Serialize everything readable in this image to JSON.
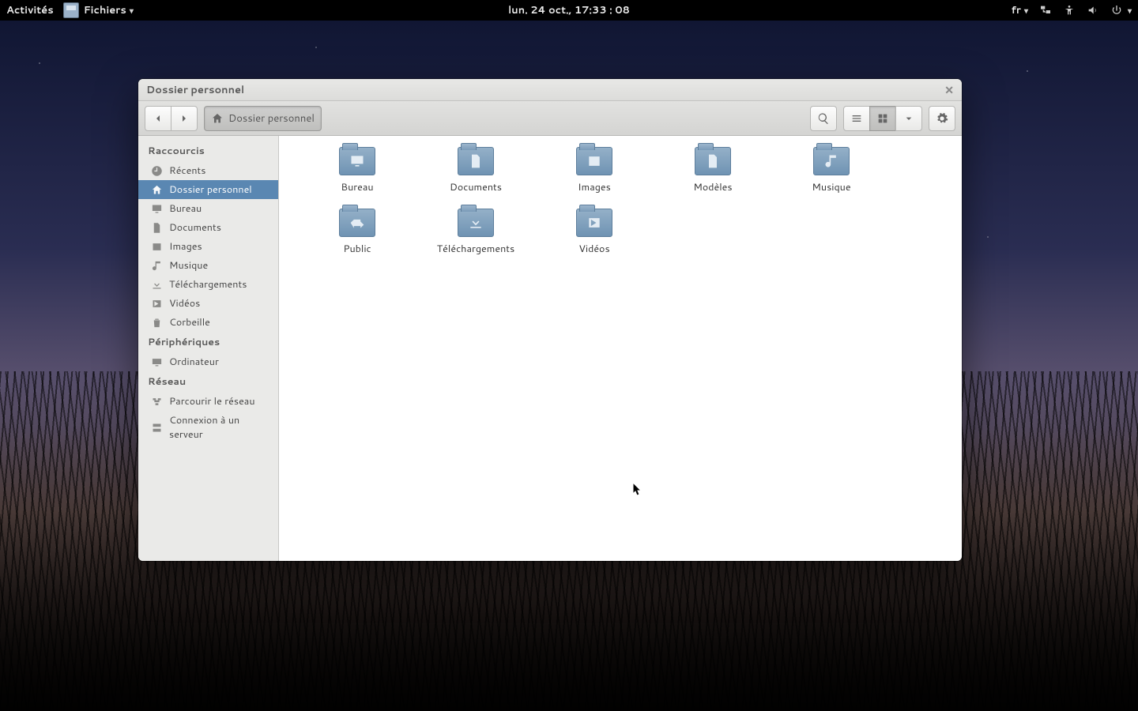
{
  "topbar": {
    "activities": "Activités",
    "app_menu": "Fichiers",
    "clock": "lun. 24 oct., 17:33 : 08",
    "keyboard_layout": "fr"
  },
  "window": {
    "title": "Dossier personnel",
    "breadcrumb": {
      "home_label": "Dossier personnel"
    }
  },
  "sidebar": {
    "headers": {
      "0": "Raccourcis",
      "1": "Périphériques",
      "2": "Réseau"
    },
    "shortcuts": [
      {
        "label": "Récents",
        "icon": "clock"
      },
      {
        "label": "Dossier personnel",
        "icon": "home",
        "selected": true
      },
      {
        "label": "Bureau",
        "icon": "desktop"
      },
      {
        "label": "Documents",
        "icon": "documents"
      },
      {
        "label": "Images",
        "icon": "images"
      },
      {
        "label": "Musique",
        "icon": "music"
      },
      {
        "label": "Téléchargements",
        "icon": "download"
      },
      {
        "label": "Vidéos",
        "icon": "videos"
      },
      {
        "label": "Corbeille",
        "icon": "trash"
      }
    ],
    "devices": [
      {
        "label": "Ordinateur",
        "icon": "computer"
      }
    ],
    "network": [
      {
        "label": "Parcourir le réseau",
        "icon": "network"
      },
      {
        "label": "Connexion à un serveur",
        "icon": "server"
      }
    ]
  },
  "files": [
    {
      "label": "Bureau",
      "emblem": "desktop"
    },
    {
      "label": "Documents",
      "emblem": "documents"
    },
    {
      "label": "Images",
      "emblem": "images"
    },
    {
      "label": "Modèles",
      "emblem": "templates"
    },
    {
      "label": "Musique",
      "emblem": "music"
    },
    {
      "label": "Public",
      "emblem": "public"
    },
    {
      "label": "Téléchargements",
      "emblem": "download"
    },
    {
      "label": "Vidéos",
      "emblem": "videos"
    }
  ],
  "colors": {
    "selection": "#5a87b2",
    "folder_top": "#94b0c8",
    "folder_bottom": "#6f93b3"
  }
}
